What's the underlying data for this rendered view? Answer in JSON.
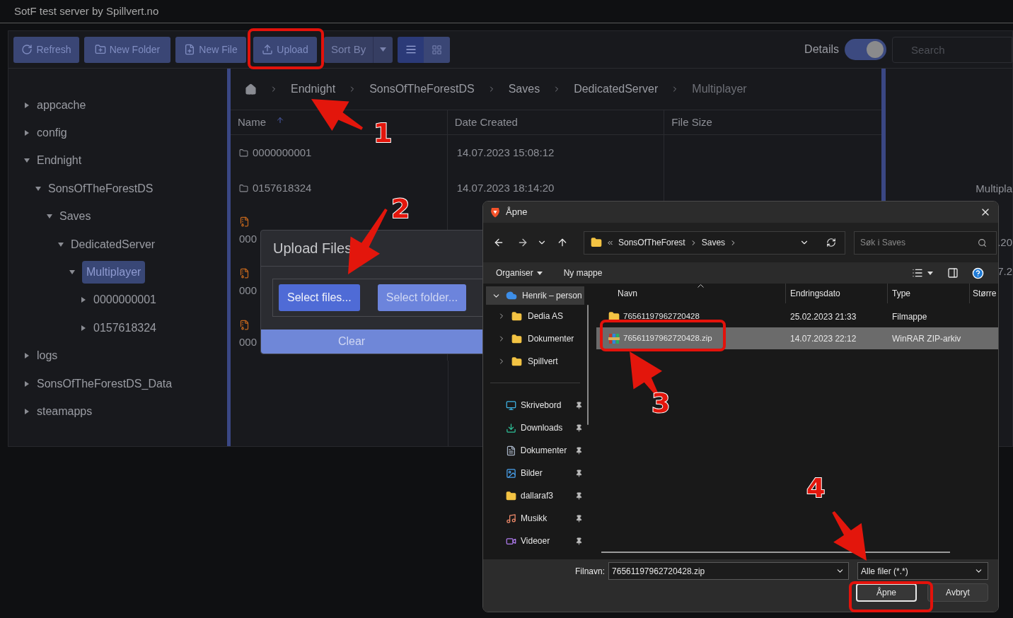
{
  "window": {
    "title": "SotF test server by Spillvert.no"
  },
  "toolbar": {
    "buttons": [
      {
        "kind": "refresh",
        "label": "Refresh"
      },
      {
        "kind": "new-folder",
        "label": "New Folder"
      },
      {
        "kind": "new-file",
        "label": "New File"
      },
      {
        "kind": "upload",
        "label": "Upload"
      }
    ],
    "sort": {
      "label": "Sort By"
    },
    "view_modes": [
      {
        "kind": "list",
        "selected": true
      },
      {
        "kind": "grid",
        "selected": false
      }
    ],
    "details_toggle": {
      "label": "Details",
      "on": true
    },
    "search": {
      "placeholder": "Search"
    }
  },
  "tree": [
    {
      "label": "appcache",
      "expanded": false,
      "selected": false
    },
    {
      "label": "config",
      "expanded": false,
      "selected": false
    },
    {
      "label": "Endnight",
      "expanded": true,
      "selected": false,
      "children": [
        {
          "label": "SonsOfTheForestDS",
          "expanded": true,
          "selected": false,
          "children": [
            {
              "label": "Saves",
              "expanded": true,
              "selected": false,
              "children": [
                {
                  "label": "DedicatedServer",
                  "expanded": true,
                  "selected": false,
                  "children": [
                    {
                      "label": "Multiplayer",
                      "expanded": true,
                      "selected": true,
                      "children": [
                        {
                          "label": "0000000001",
                          "expanded": false,
                          "selected": false
                        },
                        {
                          "label": "0157618324",
                          "expanded": false,
                          "selected": false
                        }
                      ]
                    }
                  ]
                }
              ]
            }
          ]
        }
      ]
    },
    {
      "label": "logs",
      "expanded": false,
      "selected": false
    },
    {
      "label": "SonsOfTheForestDS_Data",
      "expanded": false,
      "selected": false
    },
    {
      "label": "steamapps",
      "expanded": false,
      "selected": false
    }
  ],
  "breadcrumb": [
    "Endnight",
    "SonsOfTheForestDS",
    "Saves",
    "DedicatedServer",
    "Multiplayer"
  ],
  "table": {
    "columns": [
      {
        "label": "Name",
        "sorted": true
      },
      {
        "label": "Date Created",
        "sorted": false
      },
      {
        "label": "File Size",
        "sorted": false
      }
    ],
    "rows": [
      {
        "kind": "folder",
        "name": "0000000001",
        "created": "14.07.2023 15:08:12"
      },
      {
        "kind": "folder",
        "name": "0157618324",
        "created": "14.07.2023 18:14:20"
      },
      {
        "kind": "archive",
        "name": "000"
      },
      {
        "kind": "archive",
        "name": "000"
      },
      {
        "kind": "archive",
        "name": "000"
      }
    ]
  },
  "details_panel": {
    "lines": [
      "Multipla",
      ".20",
      "7.2"
    ]
  },
  "upload_dialog": {
    "title": "Upload Files",
    "buttons": [
      {
        "label": "Select files...",
        "selected": true
      },
      {
        "label": "Select folder...",
        "selected": false
      }
    ],
    "clear": "Clear"
  },
  "file_dialog": {
    "title": "Åpne",
    "address": [
      "SonsOfTheForest",
      "Saves"
    ],
    "search": {
      "placeholder": "Søk i Saves"
    },
    "commands": [
      "Organiser",
      "Ny mappe"
    ],
    "nav_tree": [
      {
        "label": "Henrik – person",
        "expanded": true,
        "selected": true,
        "children": [
          {
            "label": "Dedia AS",
            "expanded": false
          },
          {
            "label": "Dokumenter",
            "expanded": false
          },
          {
            "label": "Spillvert",
            "expanded": false
          }
        ]
      }
    ],
    "quick_access": [
      {
        "kind": "desktop",
        "label": "Skrivebord"
      },
      {
        "kind": "download",
        "label": "Downloads"
      },
      {
        "kind": "document",
        "label": "Dokumenter"
      },
      {
        "kind": "picture",
        "label": "Bilder"
      },
      {
        "kind": "folder",
        "label": "dallaraf3"
      },
      {
        "kind": "music",
        "label": "Musikk"
      },
      {
        "kind": "video",
        "label": "Videoer"
      }
    ],
    "columns": [
      "Navn",
      "Endringsdato",
      "Type",
      "Større"
    ],
    "files": [
      {
        "kind": "folder",
        "name": "76561197962720428",
        "modified": "25.02.2023 21:33",
        "type": "Filmappe",
        "selected": false
      },
      {
        "kind": "archive",
        "name": "76561197962720428.zip",
        "modified": "14.07.2023 22:12",
        "type": "WinRAR ZIP-arkiv",
        "selected": true
      }
    ],
    "filename_label": "Filnavn:",
    "filename": "76561197962720428.zip",
    "filter": "Alle filer (*.*)",
    "buttons": [
      {
        "label": "Åpne",
        "kind": "default"
      },
      {
        "label": "Avbryt",
        "kind": "normal"
      }
    ]
  },
  "annotations": [
    {
      "label": "1"
    },
    {
      "label": "2"
    },
    {
      "label": "3"
    },
    {
      "label": "4"
    }
  ]
}
